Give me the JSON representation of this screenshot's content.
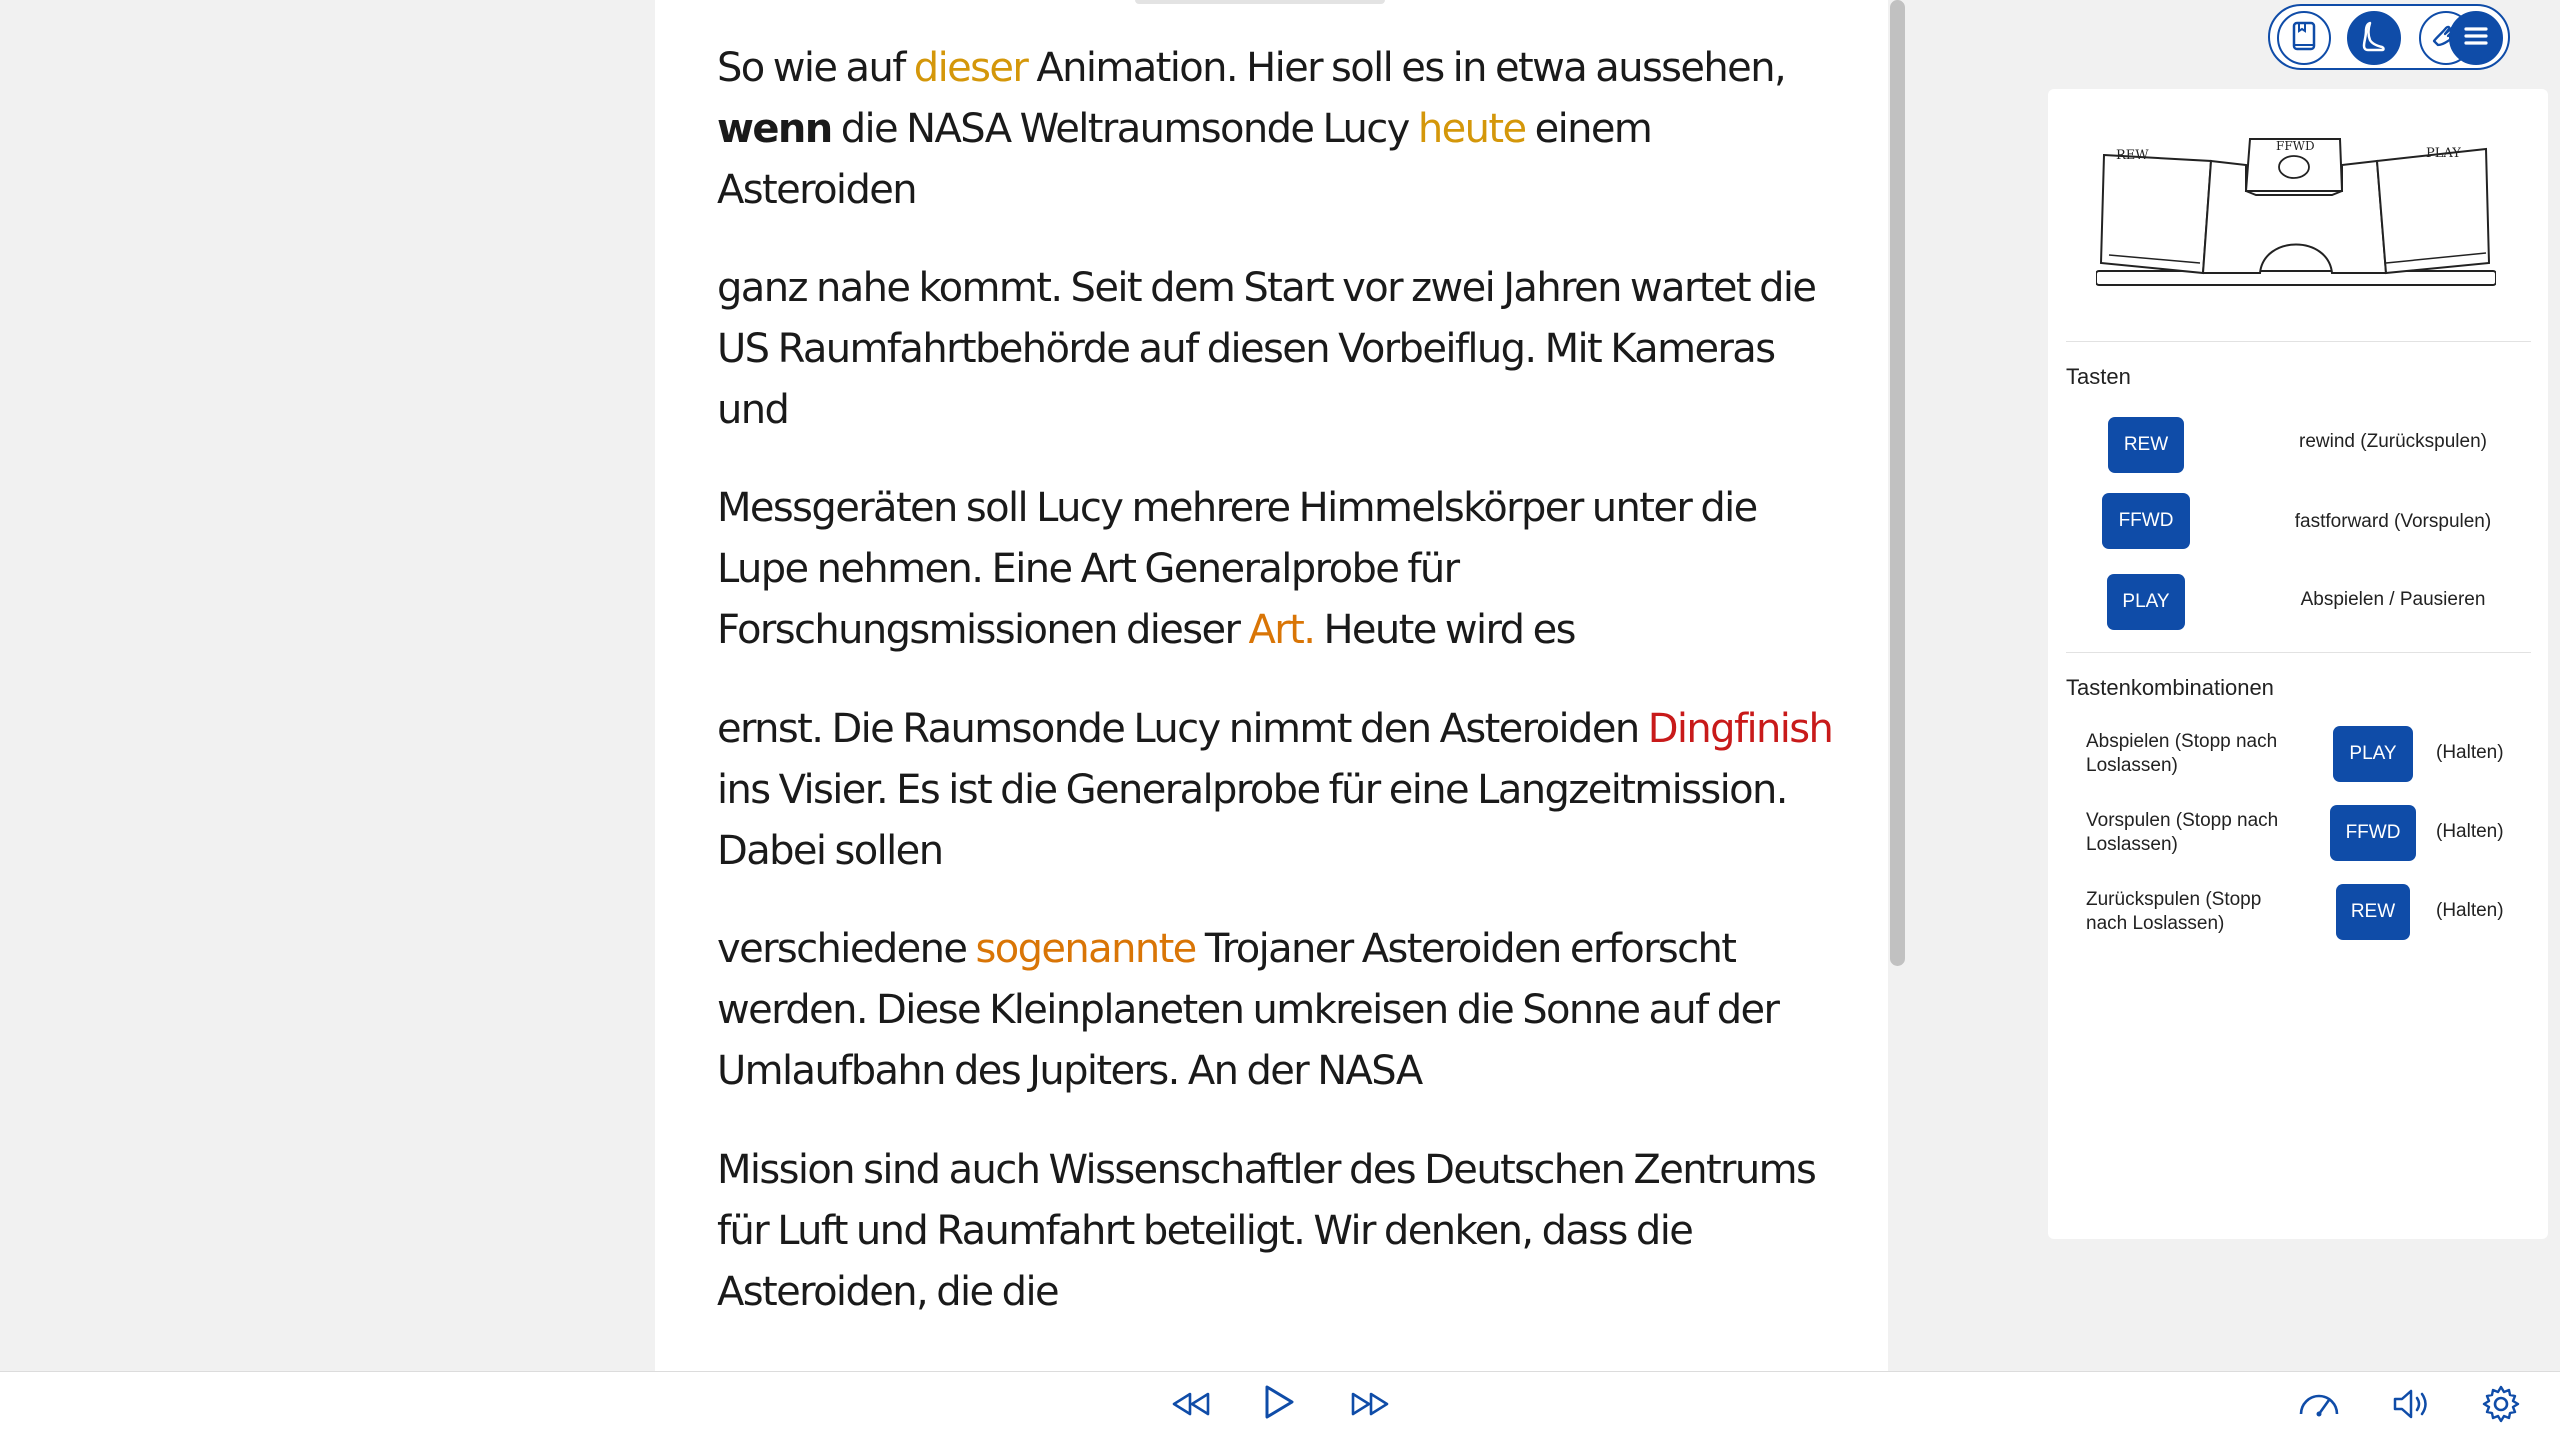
{
  "transcript": {
    "paragraphs": [
      {
        "segments": [
          {
            "text": "So wie auf ",
            "style": ""
          },
          {
            "text": "dieser",
            "style": "hl-gold"
          },
          {
            "text": " Animation. Hier soll es in etwa aussehen, ",
            "style": ""
          },
          {
            "text": "wenn",
            "style": "bold"
          },
          {
            "text": " die NASA Weltraumsonde Lucy ",
            "style": ""
          },
          {
            "text": "heute",
            "style": "hl-gold"
          },
          {
            "text": " einem Asteroiden",
            "style": ""
          }
        ]
      },
      {
        "segments": [
          {
            "text": "ganz nahe kommt. Seit dem Start vor zwei Jahren wartet die US Raumfahrtbehörde auf diesen Vorbeiflug. Mit Kameras und",
            "style": ""
          }
        ]
      },
      {
        "segments": [
          {
            "text": "Messgeräten soll Lucy mehrere Himmelskörper unter die Lupe nehmen. Eine Art Generalprobe für Forschungsmissionen dieser ",
            "style": ""
          },
          {
            "text": "Art.",
            "style": "hl-orange"
          },
          {
            "text": " Heute wird es",
            "style": ""
          }
        ]
      },
      {
        "segments": [
          {
            "text": "ernst. Die Raumsonde Lucy nimmt den Asteroiden ",
            "style": ""
          },
          {
            "text": "Dingfinish",
            "style": "hl-red"
          },
          {
            "text": " ins Visier. Es ist die Generalprobe für eine Langzeitmission. Dabei sollen",
            "style": ""
          }
        ]
      },
      {
        "segments": [
          {
            "text": "verschiedene ",
            "style": ""
          },
          {
            "text": "sogenannte",
            "style": "hl-orange"
          },
          {
            "text": " Trojaner Asteroiden erforscht werden. Diese Kleinplaneten umkreisen die Sonne auf der Umlaufbahn des Jupiters. An der NASA",
            "style": ""
          }
        ]
      },
      {
        "segments": [
          {
            "text": "Mission sind auch Wissenschaftler des Deutschen Zentrums für Luft und Raumfahrt beteiligt. Wir denken, dass die Asteroiden, die die",
            "style": ""
          }
        ]
      }
    ]
  },
  "toolbar": {
    "buttons": [
      {
        "icon": "book-icon"
      },
      {
        "icon": "foot-icon"
      },
      {
        "icon": "hand-icon"
      },
      {
        "icon": "menu-icon"
      }
    ]
  },
  "help_panel": {
    "pedal_labels": {
      "rew": "REW",
      "ffwd": "FFWD",
      "play": "PLAY"
    },
    "keys_heading": "Tasten",
    "keys": [
      {
        "key": "REW",
        "desc": "rewind (Zurückspulen)"
      },
      {
        "key": "FFWD",
        "desc": "fastforward (Vorspulen)"
      },
      {
        "key": "PLAY",
        "desc": "Abspielen / Pausieren"
      }
    ],
    "combos_heading": "Tastenkombinationen",
    "combos": [
      {
        "label": "Abspielen (Stopp nach Loslassen)",
        "key": "PLAY",
        "suffix": "(Halten)"
      },
      {
        "label": "Vorspulen (Stopp nach Loslassen)",
        "key": "FFWD",
        "suffix": "(Halten)"
      },
      {
        "label": "Zurückspulen (Stopp nach Loslassen)",
        "key": "REW",
        "suffix": "(Halten)"
      }
    ]
  },
  "player": {
    "controls": [
      {
        "icon": "rewind-icon"
      },
      {
        "icon": "play-icon"
      },
      {
        "icon": "fast-forward-icon"
      }
    ],
    "right_icons": [
      {
        "icon": "speed-gauge-icon"
      },
      {
        "icon": "volume-icon"
      },
      {
        "icon": "settings-gear-icon"
      }
    ]
  },
  "colors": {
    "accent": "#0f4ca8",
    "highlight_gold": "#d4970a",
    "highlight_orange": "#d97506",
    "highlight_red": "#c81a1a"
  }
}
